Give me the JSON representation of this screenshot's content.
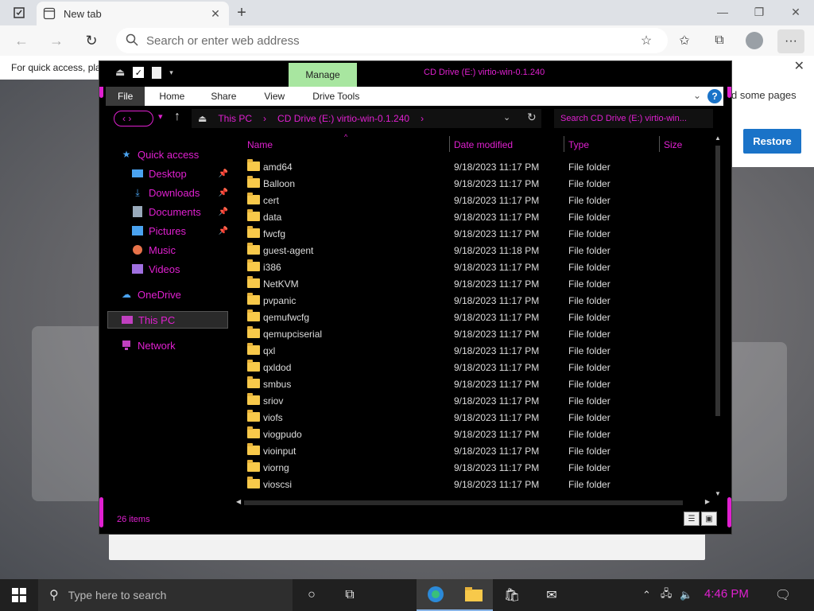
{
  "browser": {
    "tab_title": "New tab",
    "address_placeholder": "Search or enter web address",
    "infobar_text": "For quick access, pla",
    "restore_text": "d some pages",
    "restore_button": "Restore"
  },
  "explorer": {
    "manage_tab": "Manage",
    "window_title": "CD Drive (E:) virtio-win-0.1.240",
    "ribbon_tabs": [
      "File",
      "Home",
      "Share",
      "View",
      "Drive Tools"
    ],
    "path_parts": [
      "This PC",
      "CD Drive (E:) virtio-win-0.1.240"
    ],
    "search_placeholder": "Search CD Drive (E:) virtio-win...",
    "nav": {
      "quick_access": "Quick access",
      "desktop": "Desktop",
      "downloads": "Downloads",
      "documents": "Documents",
      "pictures": "Pictures",
      "music": "Music",
      "videos": "Videos",
      "onedrive": "OneDrive",
      "this_pc": "This PC",
      "network": "Network"
    },
    "columns": {
      "name": "Name",
      "date": "Date modified",
      "type": "Type",
      "size": "Size"
    },
    "rows": [
      {
        "name": "amd64",
        "date": "9/18/2023 11:17 PM",
        "type": "File folder"
      },
      {
        "name": "Balloon",
        "date": "9/18/2023 11:17 PM",
        "type": "File folder"
      },
      {
        "name": "cert",
        "date": "9/18/2023 11:17 PM",
        "type": "File folder"
      },
      {
        "name": "data",
        "date": "9/18/2023 11:17 PM",
        "type": "File folder"
      },
      {
        "name": "fwcfg",
        "date": "9/18/2023 11:17 PM",
        "type": "File folder"
      },
      {
        "name": "guest-agent",
        "date": "9/18/2023 11:18 PM",
        "type": "File folder"
      },
      {
        "name": "i386",
        "date": "9/18/2023 11:17 PM",
        "type": "File folder"
      },
      {
        "name": "NetKVM",
        "date": "9/18/2023 11:17 PM",
        "type": "File folder"
      },
      {
        "name": "pvpanic",
        "date": "9/18/2023 11:17 PM",
        "type": "File folder"
      },
      {
        "name": "qemufwcfg",
        "date": "9/18/2023 11:17 PM",
        "type": "File folder"
      },
      {
        "name": "qemupciserial",
        "date": "9/18/2023 11:17 PM",
        "type": "File folder"
      },
      {
        "name": "qxl",
        "date": "9/18/2023 11:17 PM",
        "type": "File folder"
      },
      {
        "name": "qxldod",
        "date": "9/18/2023 11:17 PM",
        "type": "File folder"
      },
      {
        "name": "smbus",
        "date": "9/18/2023 11:17 PM",
        "type": "File folder"
      },
      {
        "name": "sriov",
        "date": "9/18/2023 11:17 PM",
        "type": "File folder"
      },
      {
        "name": "viofs",
        "date": "9/18/2023 11:17 PM",
        "type": "File folder"
      },
      {
        "name": "viogpudo",
        "date": "9/18/2023 11:17 PM",
        "type": "File folder"
      },
      {
        "name": "vioinput",
        "date": "9/18/2023 11:17 PM",
        "type": "File folder"
      },
      {
        "name": "viorng",
        "date": "9/18/2023 11:17 PM",
        "type": "File folder"
      },
      {
        "name": "vioscsi",
        "date": "9/18/2023 11:17 PM",
        "type": "File folder"
      }
    ],
    "status_count": "26 items",
    "accent_color": "#e020d0"
  },
  "taskbar": {
    "search_placeholder": "Type here to search",
    "clock": "4:46 PM"
  }
}
